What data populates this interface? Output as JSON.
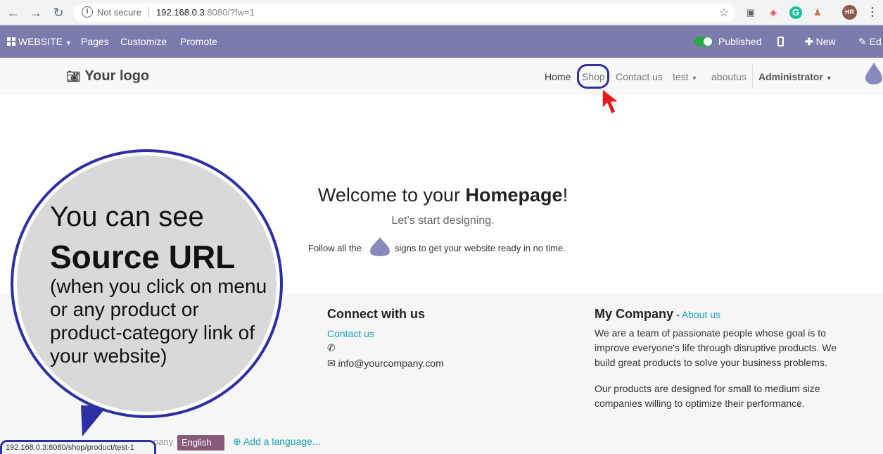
{
  "browser": {
    "not_secure": "Not secure",
    "url_host": "192.168.0.3",
    "url_rest": ":8080/?fw=1",
    "avatar": "HR"
  },
  "adminbar": {
    "website": "WEBSITE",
    "pages": "Pages",
    "customize": "Customize",
    "promote": "Promote",
    "published": "Published",
    "new": "New",
    "edit": "Ed"
  },
  "header": {
    "logo": "Your logo",
    "menu": {
      "home": "Home",
      "shop": "Shop",
      "contact": "Contact us",
      "test": "test",
      "aboutus": "aboutus",
      "admin": "Administrator"
    }
  },
  "main": {
    "welcome_prefix": "Welcome to your ",
    "welcome_bold": "Homepage",
    "welcome_suffix": "!",
    "subtitle": "Let's start designing.",
    "follow_before": "Follow all the",
    "follow_after": "signs to get your website ready in no time."
  },
  "footer": {
    "connect_title": "Connect with us",
    "contact_link": "Contact us",
    "email": "info@yourcompany.com",
    "company_title": "My Company",
    "company_sep": " - ",
    "about_link": "About us",
    "para1": "We are a team of passionate people whose goal is to improve everyone's life through disruptive products. We build great products to solve your business problems.",
    "para2": "Our products are designed for small to medium size companies willing to optimize their performance.",
    "company_fragment": "pany",
    "language": "English",
    "add_language": "Add a language..."
  },
  "callout": {
    "line1": "You can see",
    "line2": "Source URL",
    "line3": "(when you click on menu or any product or product-category link of your website)"
  },
  "statusbar": {
    "url": "192.168.0.3:8080/shop/product/test-1"
  },
  "colors": {
    "admin_bar": "#7c7bad",
    "annotation_blue": "#2d2fa5",
    "link_teal": "#17a2b8",
    "lang_purple": "#875a7b",
    "arrow_red": "#e8191b"
  }
}
